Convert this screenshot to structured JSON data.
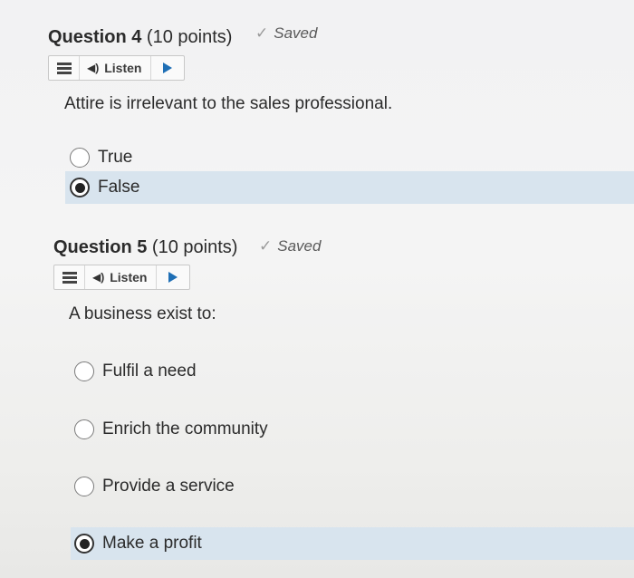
{
  "questions": [
    {
      "number_label": "Question 4",
      "points_label": "(10 points)",
      "saved_label": "Saved",
      "listen_label": "Listen",
      "prompt": "Attire is irrelevant to the sales professional.",
      "options": [
        {
          "label": "True",
          "selected": false
        },
        {
          "label": "False",
          "selected": true
        }
      ]
    },
    {
      "number_label": "Question 5",
      "points_label": "(10 points)",
      "saved_label": "Saved",
      "listen_label": "Listen",
      "prompt": "A business exist to:",
      "options": [
        {
          "label": "Fulfil a need",
          "selected": false
        },
        {
          "label": "Enrich the community",
          "selected": false
        },
        {
          "label": "Provide a service",
          "selected": false
        },
        {
          "label": "Make a profit",
          "selected": true
        }
      ]
    }
  ],
  "icons": {
    "saved": "checkmark-icon",
    "menu": "hamburger-menu-icon",
    "speaker": "speaker-icon",
    "play": "play-icon"
  },
  "colors": {
    "selected_row_bg": "#d8e4ee",
    "play_icon": "#1f6fb5"
  }
}
